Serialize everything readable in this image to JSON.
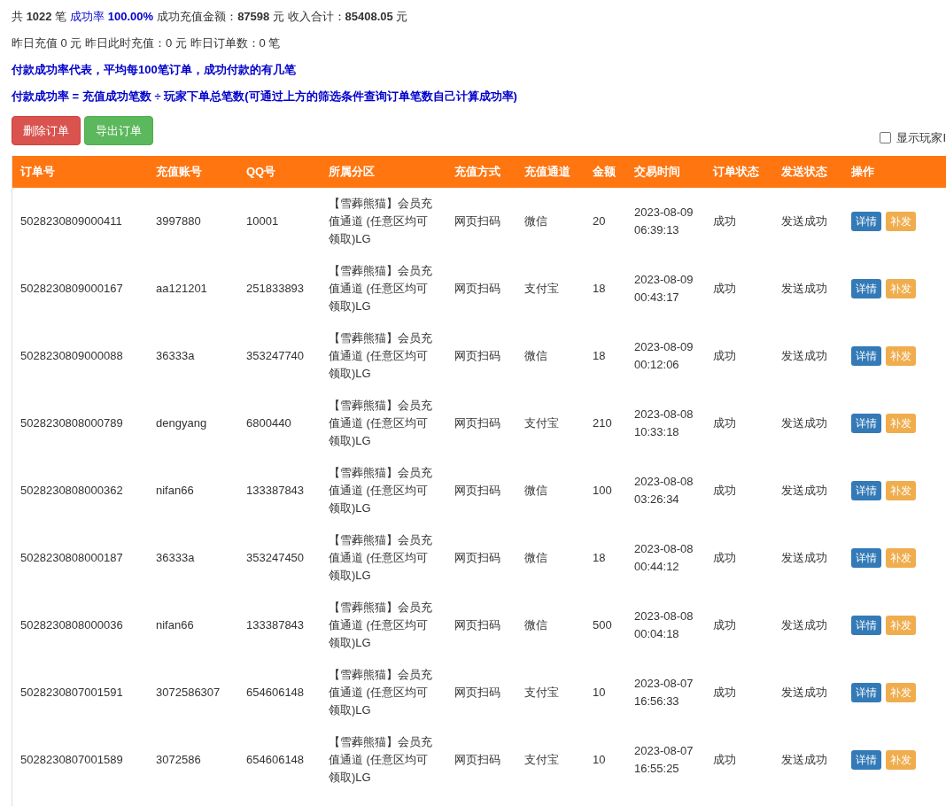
{
  "summary": {
    "line_1": "共 **1022** 笔",
    "rate": "成功率 **100.00%**",
    "line_1_rest": "成功充值金额：**87598** 元 收入合计：**85408.05** 元",
    "line_2": "昨日充值 0 元 昨日此时充值：0 元 昨日订单数：0 笔"
  },
  "notes": [
    "付款成功率代表，平均每100笔订单，成功付款的有几笔",
    "付款成功率 = 充值成功笔数 ÷ 玩家下单总笔数(可通过上方的筛选条件查询订单笔数自己计算成功率)"
  ],
  "buttons": [
    {
      "kind": "danger",
      "label": "删除订单"
    },
    {
      "kind": "success",
      "label": "导出订单"
    }
  ],
  "show_ip": {
    "label": "显示玩家I",
    "checked": false
  },
  "table": {
    "columns": [
      "订单号",
      "充值账号",
      "QQ号",
      "所属分区",
      "充值方式",
      "充值通道",
      "金额",
      "交易时间",
      "订单状态",
      "发送状态",
      "操作"
    ],
    "rows": [
      {
        "cells": [
          "5028230809000411",
          "3997880",
          "10001",
          "【雪葬熊猫】会员充值通道 (任意区均可领取)LG",
          "网页扫码",
          "微信",
          "20",
          "2023-08-09 06:39:13",
          "成功",
          "发送成功"
        ],
        "actions": [
          {
            "kind": "primary",
            "label": "详情"
          },
          {
            "kind": "warning",
            "label": "补发"
          }
        ]
      },
      {
        "cells": [
          "5028230809000167",
          "aa121201",
          "251833893",
          "【雪葬熊猫】会员充值通道 (任意区均可领取)LG",
          "网页扫码",
          "支付宝",
          "18",
          "2023-08-09 00:43:17",
          "成功",
          "发送成功"
        ],
        "actions": [
          {
            "kind": "primary",
            "label": "详情"
          },
          {
            "kind": "warning",
            "label": "补发"
          }
        ]
      },
      {
        "cells": [
          "5028230809000088",
          "36333a",
          "353247740",
          "【雪葬熊猫】会员充值通道 (任意区均可领取)LG",
          "网页扫码",
          "微信",
          "18",
          "2023-08-09 00:12:06",
          "成功",
          "发送成功"
        ],
        "actions": [
          {
            "kind": "primary",
            "label": "详情"
          },
          {
            "kind": "warning",
            "label": "补发"
          }
        ]
      },
      {
        "cells": [
          "5028230808000789",
          "dengyang",
          "6800440",
          "【雪葬熊猫】会员充值通道 (任意区均可领取)LG",
          "网页扫码",
          "支付宝",
          "210",
          "2023-08-08 10:33:18",
          "成功",
          "发送成功"
        ],
        "actions": [
          {
            "kind": "primary",
            "label": "详情"
          },
          {
            "kind": "warning",
            "label": "补发"
          }
        ]
      },
      {
        "cells": [
          "5028230808000362",
          "nifan66",
          "133387843",
          "【雪葬熊猫】会员充值通道 (任意区均可领取)LG",
          "网页扫码",
          "微信",
          "100",
          "2023-08-08 03:26:34",
          "成功",
          "发送成功"
        ],
        "actions": [
          {
            "kind": "primary",
            "label": "详情"
          },
          {
            "kind": "warning",
            "label": "补发"
          }
        ]
      },
      {
        "cells": [
          "5028230808000187",
          "36333a",
          "353247450",
          "【雪葬熊猫】会员充值通道 (任意区均可领取)LG",
          "网页扫码",
          "微信",
          "18",
          "2023-08-08 00:44:12",
          "成功",
          "发送成功"
        ],
        "actions": [
          {
            "kind": "primary",
            "label": "详情"
          },
          {
            "kind": "warning",
            "label": "补发"
          }
        ]
      },
      {
        "cells": [
          "5028230808000036",
          "nifan66",
          "133387843",
          "【雪葬熊猫】会员充值通道 (任意区均可领取)LG",
          "网页扫码",
          "微信",
          "500",
          "2023-08-08 00:04:18",
          "成功",
          "发送成功"
        ],
        "actions": [
          {
            "kind": "primary",
            "label": "详情"
          },
          {
            "kind": "warning",
            "label": "补发"
          }
        ]
      },
      {
        "cells": [
          "5028230807001591",
          "3072586307",
          "654606148",
          "【雪葬熊猫】会员充值通道 (任意区均可领取)LG",
          "网页扫码",
          "支付宝",
          "10",
          "2023-08-07 16:56:33",
          "成功",
          "发送成功"
        ],
        "actions": [
          {
            "kind": "primary",
            "label": "详情"
          },
          {
            "kind": "warning",
            "label": "补发"
          }
        ]
      },
      {
        "cells": [
          "5028230807001589",
          "3072586",
          "654606148",
          "【雪葬熊猫】会员充值通道 (任意区均可领取)LG",
          "网页扫码",
          "支付宝",
          "10",
          "2023-08-07 16:55:25",
          "成功",
          "发送成功"
        ],
        "actions": [
          {
            "kind": "primary",
            "label": "详情"
          },
          {
            "kind": "warning",
            "label": "补发"
          }
        ]
      }
    ]
  }
}
